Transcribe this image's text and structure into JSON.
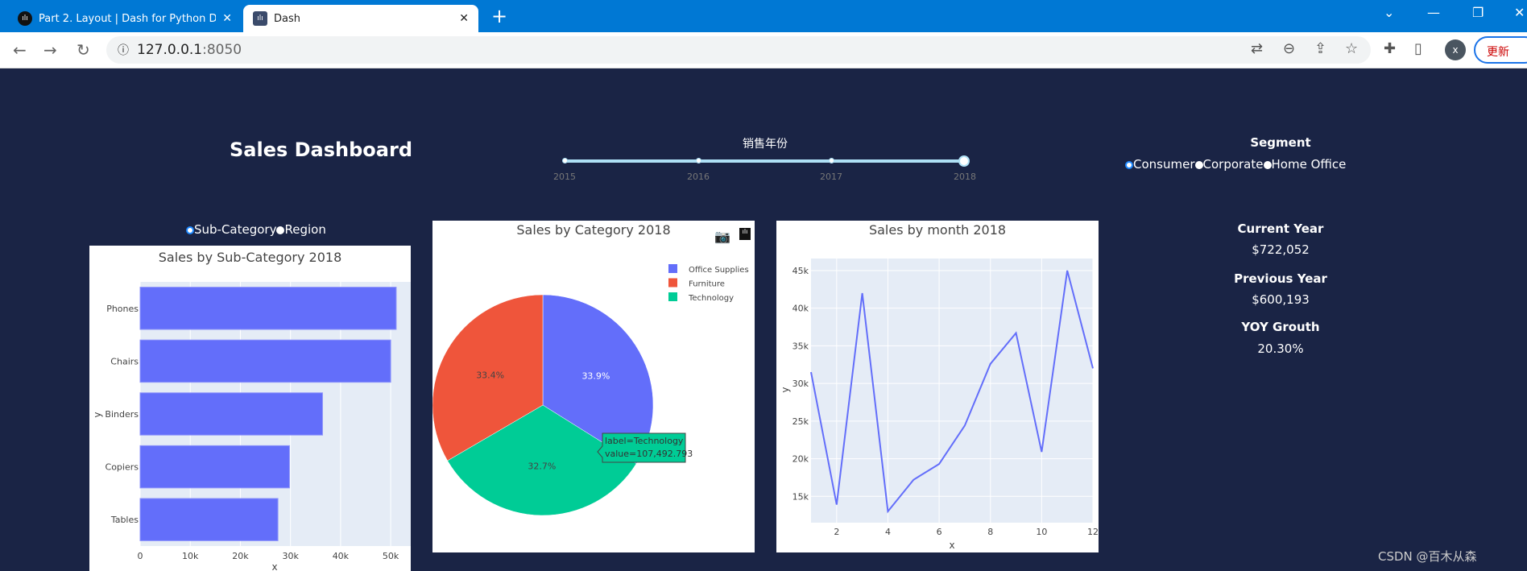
{
  "browser": {
    "tabs": [
      {
        "title": "Part 2. Layout | Dash for Python D",
        "icon": "dash-icon"
      },
      {
        "title": "Dash",
        "icon": "dash-icon"
      }
    ],
    "url_host": "127.0.0.1",
    "url_port": ":8050",
    "update_label": "更新",
    "avatar_letter": "x"
  },
  "header": {
    "title": "Sales Dashboard",
    "slider_label": "销售年份",
    "slider_ticks": [
      "2015",
      "2016",
      "2017",
      "2018"
    ],
    "slider_value": "2018",
    "segment_label": "Segment",
    "segments": [
      "Consumer",
      "Corporate",
      "Home Office"
    ],
    "segment_selected": "Consumer"
  },
  "groupby": {
    "options": [
      "Sub-Category",
      "Region"
    ],
    "selected": "Sub-Category"
  },
  "kpis": [
    {
      "label": "Current Year",
      "value": "$722,052"
    },
    {
      "label": "Previous Year",
      "value": "$600,193"
    },
    {
      "label": "YOY Grouth",
      "value": "20.30%"
    }
  ],
  "watermark": "CSDN @百木从森",
  "colors": {
    "bg": "#1a2445",
    "blue": "#636efa",
    "red": "#ef553b",
    "green": "#00cc96",
    "plot_bg": "#e5ecf6"
  },
  "chart_data": [
    {
      "type": "bar",
      "orientation": "horizontal",
      "title": "Sales by Sub-Category 2018",
      "xlabel": "x",
      "ylabel": "y",
      "categories": [
        "Phones",
        "Chairs",
        "Binders",
        "Copiers",
        "Tables"
      ],
      "values": [
        51100,
        50000,
        36400,
        29800,
        27500
      ],
      "xticks": [
        "0",
        "10k",
        "20k",
        "30k",
        "40k",
        "50k"
      ],
      "xlim": [
        0,
        54000
      ],
      "grid": true
    },
    {
      "type": "pie",
      "title": "Sales by Category 2018",
      "labels": [
        "Office Supplies",
        "Technology",
        "Furniture"
      ],
      "percents": [
        33.9,
        32.7,
        33.4
      ],
      "percent_labels": [
        "33.9%",
        "32.7%",
        "33.4%"
      ],
      "legend": [
        "Office Supplies",
        "Furniture",
        "Technology"
      ],
      "legend_placement": "top-right",
      "tooltip": {
        "line1": "label=Technology",
        "line2": "value=107,492.793"
      }
    },
    {
      "type": "line",
      "title": "Sales by month 2018",
      "xlabel": "x",
      "ylabel": "y",
      "x": [
        1,
        2,
        3,
        4,
        5,
        6,
        7,
        8,
        9,
        10,
        11,
        12
      ],
      "y": [
        31500,
        13900,
        42000,
        13000,
        17200,
        19300,
        24400,
        32600,
        36700,
        20900,
        45000,
        32000
      ],
      "xticks": [
        "2",
        "4",
        "6",
        "8",
        "10",
        "12"
      ],
      "yticks": [
        "15k",
        "20k",
        "25k",
        "30k",
        "35k",
        "40k",
        "45k"
      ],
      "ylim": [
        11500,
        46600
      ],
      "grid": true
    }
  ]
}
